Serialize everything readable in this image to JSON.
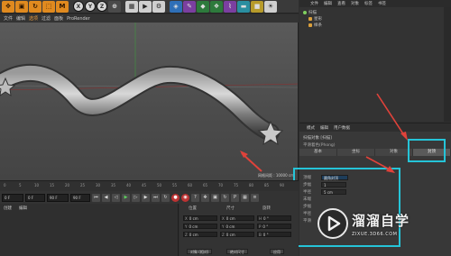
{
  "toolbar": {
    "buttons": [
      "M",
      "X",
      "Y",
      "Z"
    ]
  },
  "menubar": {
    "items": [
      "文件",
      "编辑",
      "选项",
      "过滤",
      "面板",
      "ProRender"
    ],
    "active_index": 2
  },
  "object_manager": {
    "menu": [
      "文件",
      "编辑",
      "查看",
      "对象",
      "标签",
      "书签"
    ],
    "objects": [
      "扫描",
      "星形",
      "样条"
    ]
  },
  "attributes": {
    "menu": [
      "模式",
      "编辑",
      "用户数据"
    ],
    "title": "扫描对象 [扫描]",
    "subtitle": "平滑着色(Phong)",
    "tabs": [
      "基本",
      "坐标",
      "对象",
      "封顶"
    ],
    "selected_tab_index": 3,
    "rows": [
      {
        "key": "顶端",
        "value": "圆角封顶"
      },
      {
        "key": "步幅",
        "value": "1"
      },
      {
        "key": "半径",
        "value": "5 cm"
      },
      {
        "key": "末端",
        "value": ""
      },
      {
        "key": "步幅",
        "value": ""
      },
      {
        "key": "半径",
        "value": ""
      },
      {
        "key": "平滑",
        "value": ""
      }
    ]
  },
  "viewport": {
    "grid_label": "网格间距 : 10000 cm"
  },
  "timeline": {
    "ticks": [
      "0",
      "5",
      "10",
      "15",
      "20",
      "25",
      "30",
      "35",
      "40",
      "45",
      "50",
      "55",
      "60",
      "65",
      "70",
      "75",
      "80",
      "85",
      "90"
    ]
  },
  "transport": {
    "start_field": "0 F",
    "current_field": "0 F",
    "end_field": "90 F",
    "end2_field": "90 F"
  },
  "material_panel": {
    "menu": [
      "创建",
      "编辑"
    ]
  },
  "coordinates": {
    "headers": [
      "位置",
      "尺寸",
      "旋转"
    ],
    "rows": [
      {
        "axis": "X",
        "pos": "0 cm",
        "size": "0 cm",
        "rot_axis": "H",
        "rot": "0 °"
      },
      {
        "axis": "Y",
        "pos": "0 cm",
        "size": "0 cm",
        "rot_axis": "P",
        "rot": "0 °"
      },
      {
        "axis": "Z",
        "pos": "0 cm",
        "size": "0 cm",
        "rot_axis": "B",
        "rot": "0 °"
      }
    ],
    "mode_button": "对象 (相对)",
    "size_button": "绝对尺寸",
    "apply_button": "应用"
  },
  "watermark": {
    "title": "溜溜自学",
    "url": "ZIXUE.3D66.COM"
  },
  "colors": {
    "highlight": "#25c4d8",
    "arrow": "#e0423a",
    "accent_orange": "#e08a1f"
  }
}
